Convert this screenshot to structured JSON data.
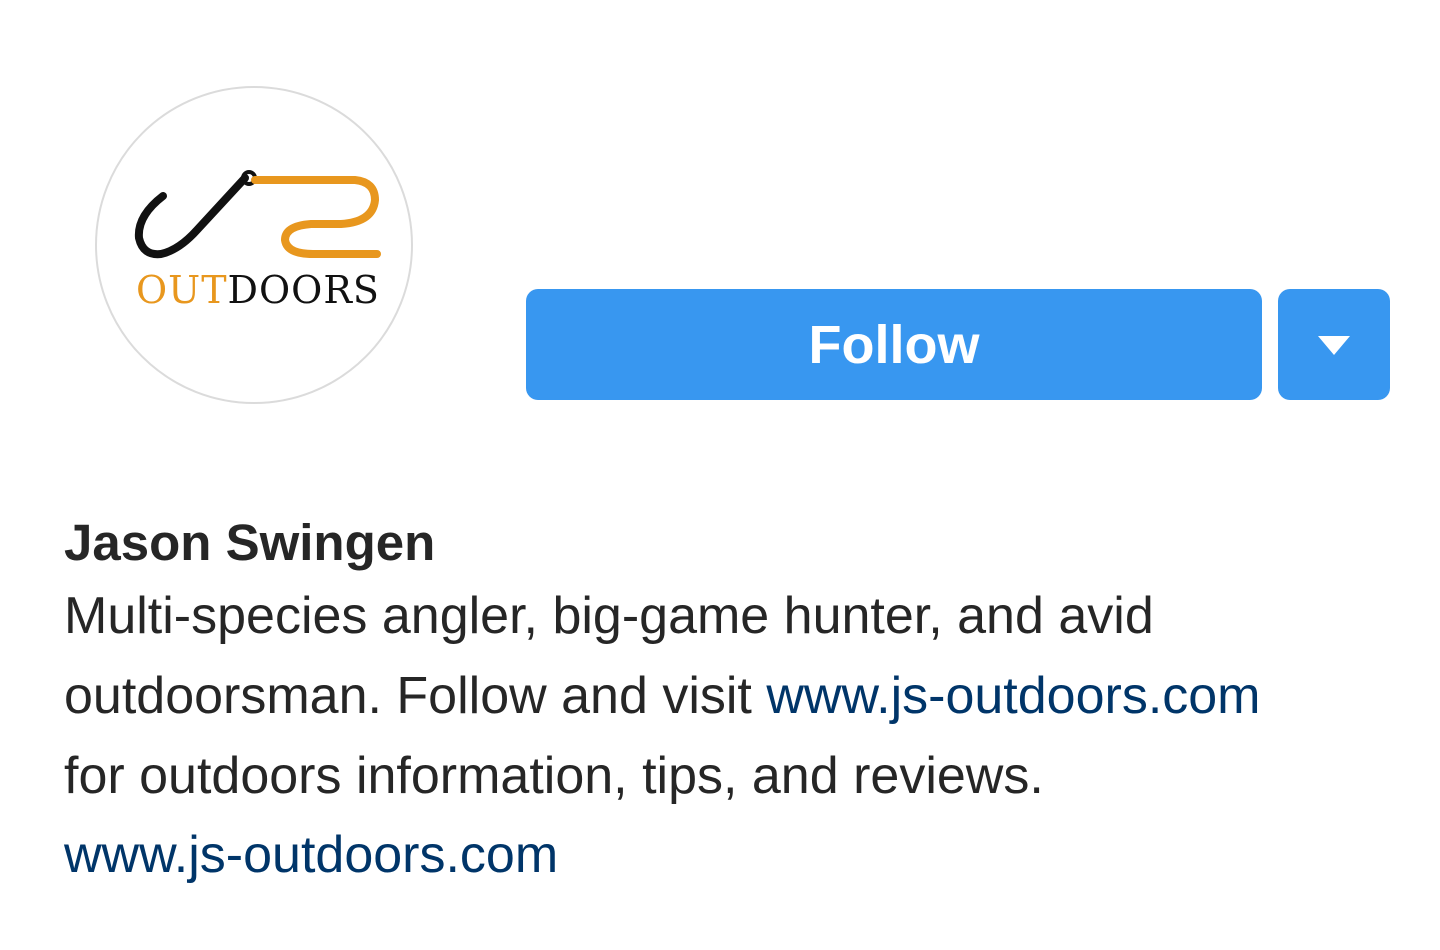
{
  "profile": {
    "avatar_logo": {
      "text_part_1": "OUT",
      "text_part_2": "DOORS",
      "colors": {
        "orange": "#e8971e",
        "black": "#111111"
      }
    },
    "follow_label": "Follow",
    "name": "Jason Swingen",
    "bio": {
      "line1": "Multi-species angler, big-game hunter, and avid",
      "line2_prefix": "outdoorsman. Follow and visit ",
      "line2_link": "www.js-outdoors.com",
      "line3": "for outdoors information, tips, and reviews."
    },
    "website": "www.js-outdoors.com"
  },
  "icons": {
    "dropdown": "caret-down-icon",
    "logo": "fishing-hook-icon"
  },
  "colors": {
    "button_blue": "#3897f0",
    "link_blue": "#003569",
    "text": "#262626",
    "avatar_border": "#dbdbdb"
  }
}
